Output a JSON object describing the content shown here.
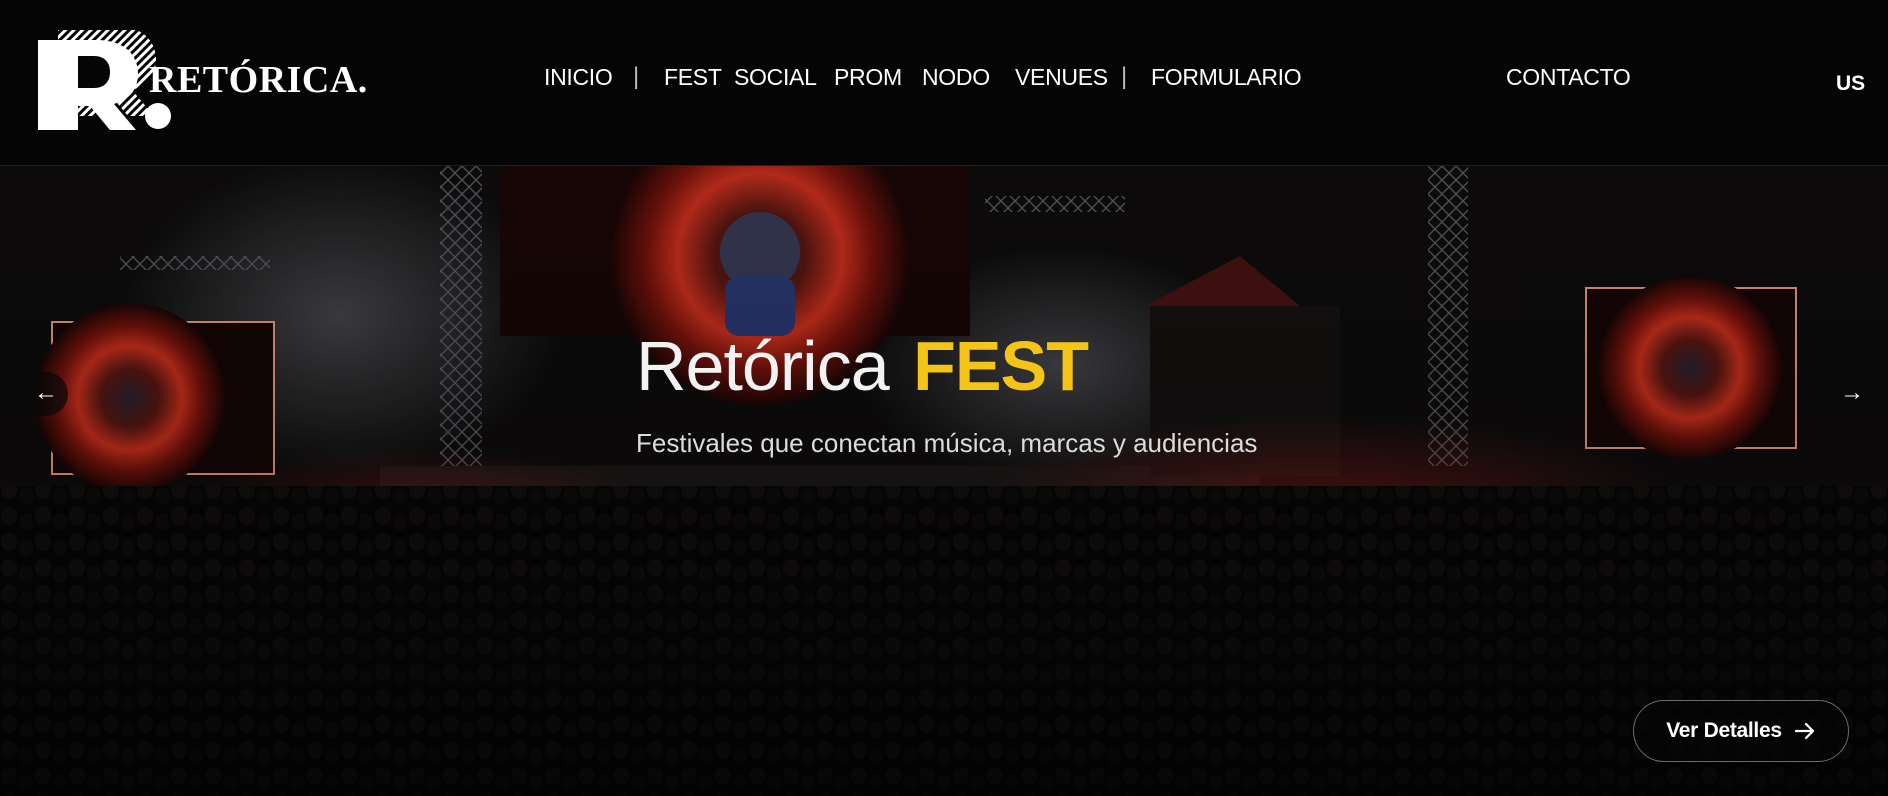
{
  "brand": {
    "name": "RETÓRICA.",
    "mark": "R."
  },
  "nav": {
    "items": [
      {
        "label": "INICIO"
      },
      {
        "label": "FEST"
      },
      {
        "label": "SOCIAL"
      },
      {
        "label": "PROM"
      },
      {
        "label": "NODO"
      },
      {
        "label": "VENUES"
      },
      {
        "label": "FORMULARIO"
      }
    ],
    "separator": "|",
    "contact": "CONTACTO",
    "language": "US"
  },
  "hero": {
    "title_light": "Retórica",
    "title_bold": "FEST",
    "subtitle": "Festivales que conectan música, marcas y audiencias",
    "prev_arrow": "←",
    "next_arrow": "→",
    "cta_label": "Ver Detalles"
  },
  "colors": {
    "accent": "#f5c418",
    "background": "#050505",
    "text": "#ffffff"
  },
  "icons": {
    "prev": "arrow-left-icon",
    "next": "arrow-right-icon",
    "cta": "arrow-right-icon"
  }
}
